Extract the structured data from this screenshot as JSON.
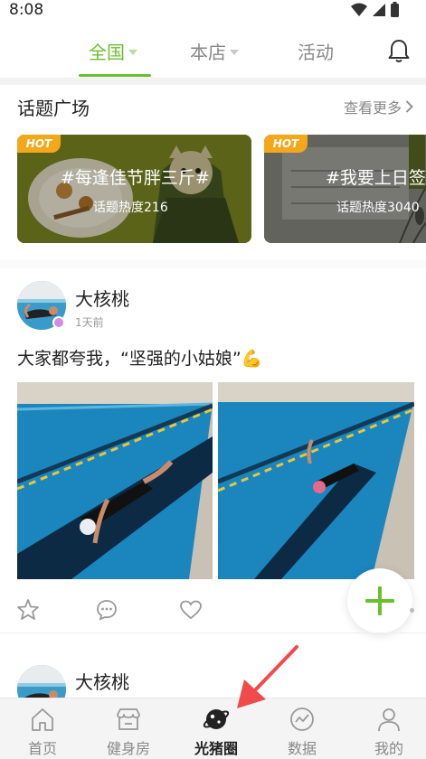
{
  "status_bar": {
    "time": "8:08"
  },
  "top_tabs": [
    {
      "label": "全国",
      "active": true,
      "has_caret": true
    },
    {
      "label": "本店",
      "active": false,
      "has_caret": true
    },
    {
      "label": "活动",
      "active": false,
      "has_caret": false
    }
  ],
  "topic_section": {
    "title": "话题广场",
    "more": "查看更多",
    "cards": [
      {
        "badge": "HOT",
        "name": "#每逢佳节胖三斤#",
        "heat": "话题热度216"
      },
      {
        "badge": "HOT",
        "name": "#我要上日签",
        "heat": "话题热度3040"
      }
    ]
  },
  "posts": [
    {
      "user": "大核桃",
      "time": "1天前",
      "text": "大家都夸我，“坚强的小姑娘”💪"
    },
    {
      "user": "大核桃"
    }
  ],
  "colors": {
    "accent": "#6cbf2e",
    "hot_badge": "#f3a81c",
    "arrow": "#f04a4a"
  },
  "bottom_nav": [
    {
      "label": "首页",
      "icon": "home-icon",
      "active": false
    },
    {
      "label": "健身房",
      "icon": "store-icon",
      "active": false
    },
    {
      "label": "光猪圈",
      "icon": "planet-icon",
      "active": true
    },
    {
      "label": "数据",
      "icon": "chart-icon",
      "active": false
    },
    {
      "label": "我的",
      "icon": "person-icon",
      "active": false
    }
  ]
}
